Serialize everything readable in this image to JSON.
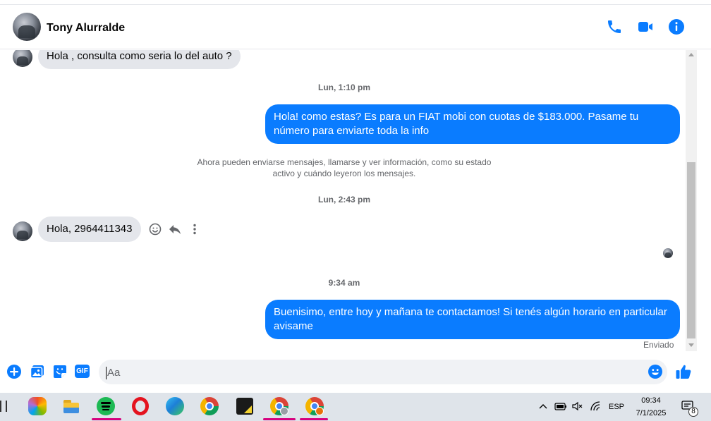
{
  "header": {
    "contact_name": "Tony Alurralde",
    "icons": [
      "phone-icon",
      "video-camera-icon",
      "info-icon"
    ]
  },
  "messages": {
    "incoming_1": "Hola ,  consulta como seria lo del auto ?",
    "timestamp_1": "Lun, 1:10 pm",
    "outgoing_1": "Hola! como estas? Es para un FIAT mobi con cuotas de $183.000. Pasame tu número para enviarte toda la info",
    "system_note_line1": "Ahora pueden enviarse mensajes, llamarse y ver información, como su estado",
    "system_note_line2": "activo y cuándo leyeron los mensajes.",
    "timestamp_2": "Lun, 2:43 pm",
    "incoming_2": "Hola,  2964411343",
    "timestamp_3": "9:34 am",
    "outgoing_2": "Buenisimo, entre hoy y mañana te contactamos! Si tenés algún horario en particular avisame",
    "status": "Enviado"
  },
  "composer": {
    "placeholder": "Aa",
    "icons": [
      "add-icon",
      "image-icon",
      "sticker-icon",
      "gif-icon",
      "emoji-icon",
      "like-icon"
    ],
    "gif_label": "GIF"
  },
  "taskbar": {
    "language": "ESP",
    "time": "09:34",
    "date": "7/1/2025",
    "notification_count": "8"
  },
  "colors": {
    "accent": "#0a7cff",
    "incoming_bubble": "#e4e6eb",
    "taskbar": "#dfe4ea"
  }
}
